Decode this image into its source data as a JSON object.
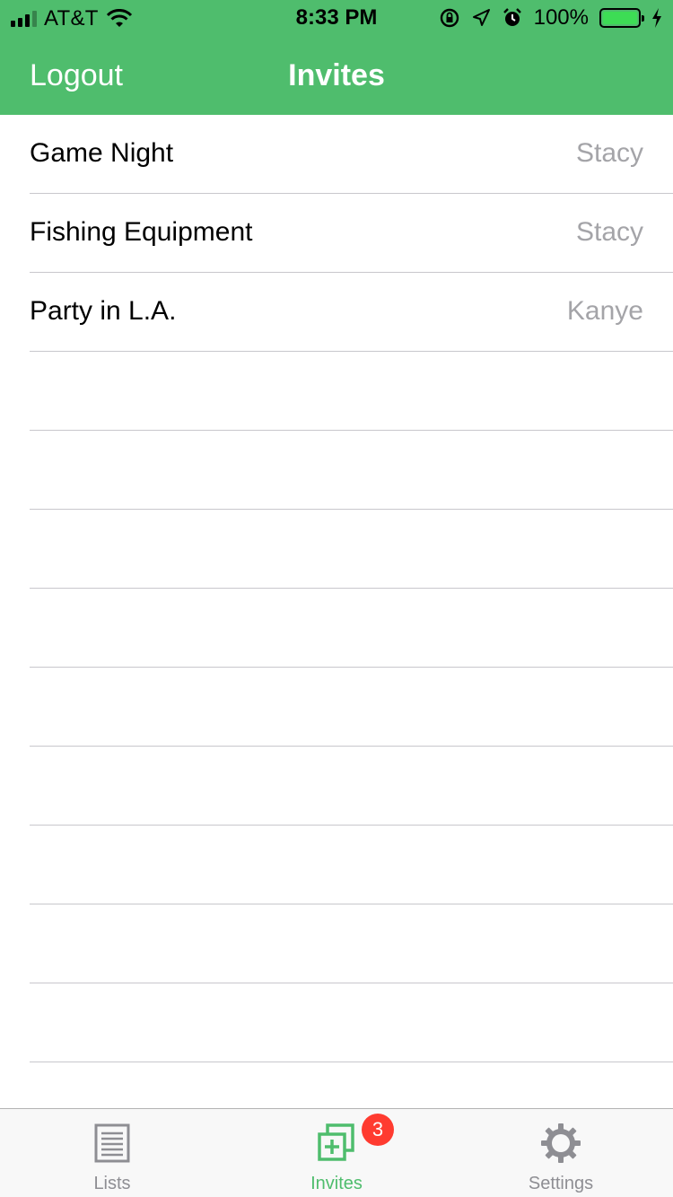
{
  "status_bar": {
    "carrier": "AT&T",
    "time": "8:33 PM",
    "battery_percent": "100%",
    "icons": [
      "signal-icon",
      "wifi-icon",
      "rotation-lock-icon",
      "location-icon",
      "alarm-icon",
      "battery-icon",
      "charging-icon"
    ]
  },
  "nav": {
    "left_button": "Logout",
    "title": "Invites"
  },
  "invites": [
    {
      "title": "Game Night",
      "owner": "Stacy"
    },
    {
      "title": "Fishing Equipment",
      "owner": "Stacy"
    },
    {
      "title": "Party in L.A.",
      "owner": "Kanye"
    }
  ],
  "tab_bar": {
    "tabs": [
      {
        "label": "Lists",
        "icon": "list-icon"
      },
      {
        "label": "Invites",
        "icon": "invites-icon",
        "badge": "3"
      },
      {
        "label": "Settings",
        "icon": "gear-icon"
      }
    ],
    "selected": "Invites"
  },
  "colors": {
    "accent": "#4fbd6d",
    "badge": "#ff3b30",
    "secondary_text": "#a4a4a8",
    "separator": "#c8c7cc"
  }
}
